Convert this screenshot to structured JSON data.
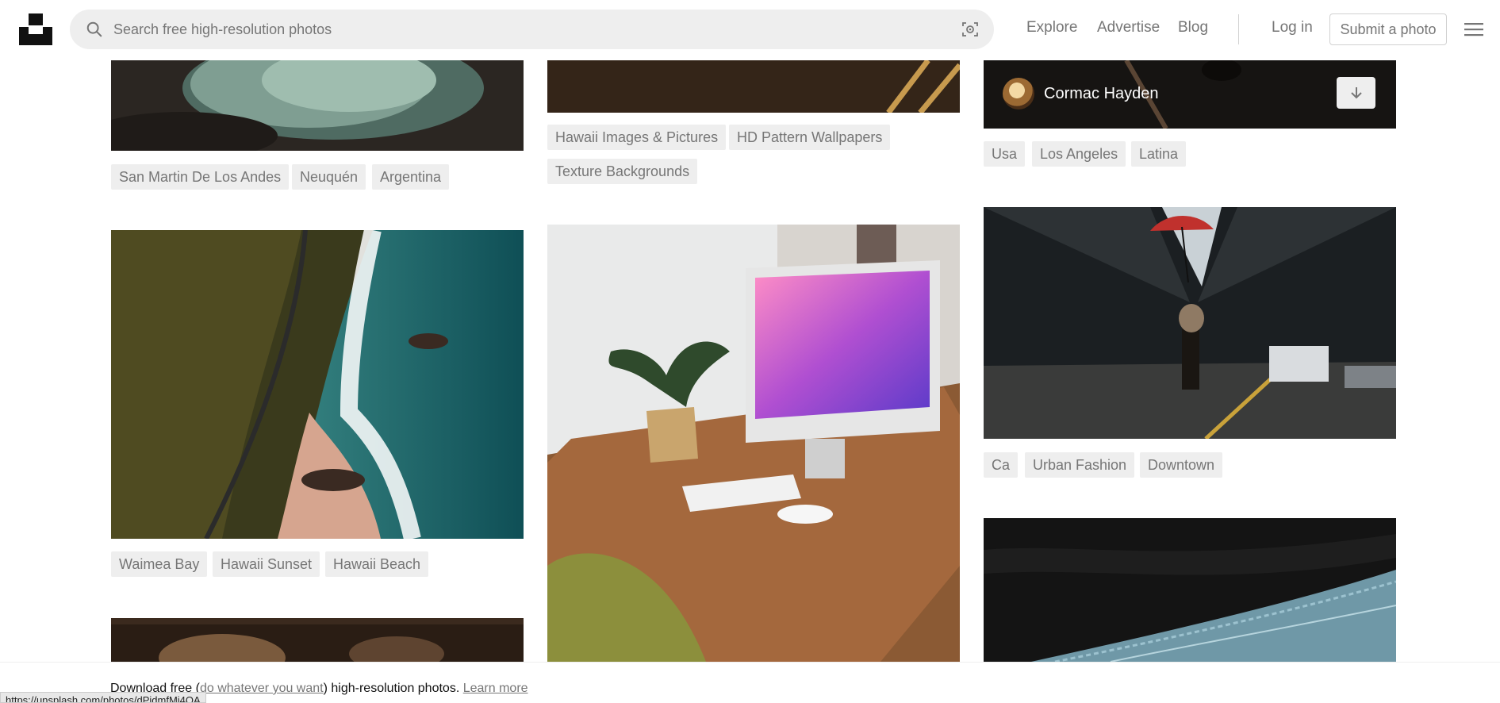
{
  "header": {
    "search_placeholder": "Search free high-resolution photos",
    "nav": [
      "Explore",
      "Advertise",
      "Blog"
    ],
    "login": "Log in",
    "submit": "Submit a photo"
  },
  "columns": {
    "left": {
      "tags_top": [
        "San Martin De Los Andes",
        "Neuquén",
        "Argentina"
      ],
      "tags_middle": [
        "Waimea Bay",
        "Hawaii Sunset",
        "Hawaii Beach"
      ]
    },
    "center": {
      "tags_top": [
        "Hawaii Images & Pictures",
        "HD Pattern Wallpapers",
        "Texture Backgrounds"
      ]
    },
    "right": {
      "author_name": "Cormac Hayden",
      "tags_top": [
        "Usa",
        "Los Angeles",
        "Latina"
      ],
      "tags_middle": [
        "Ca",
        "Urban Fashion",
        "Downtown"
      ]
    }
  },
  "banner": {
    "prefix": "Download free (",
    "link1": "do whatever you want",
    "middle": ") high-resolution photos. ",
    "link2": "Learn more"
  },
  "status_url": "https://unsplash.com/photos/dPidmfMi4QA",
  "icons": {
    "logo": "unsplash-logo",
    "search": "search-icon",
    "visual_search": "visual-search-icon",
    "menu": "hamburger-menu-icon",
    "download": "arrow-down-icon"
  }
}
